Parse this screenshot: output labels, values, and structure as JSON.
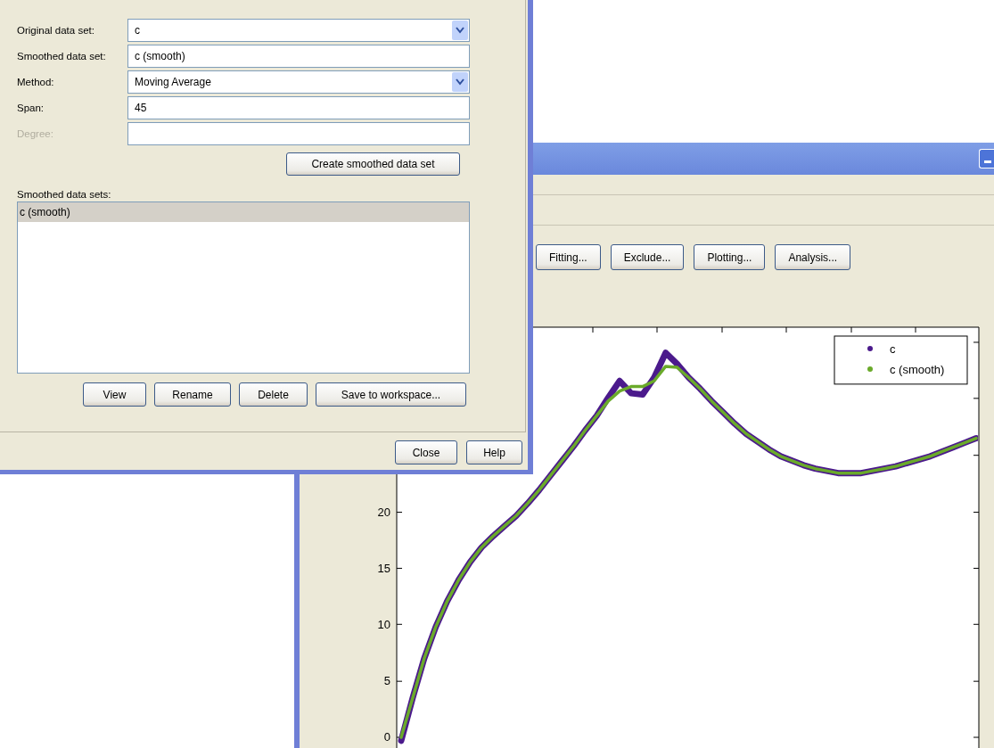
{
  "dialog": {
    "fields": [
      {
        "label": "Original data set:",
        "kind": "dropdown",
        "value": "c",
        "disabled": false
      },
      {
        "label": "Smoothed data set:",
        "kind": "text",
        "value": "c (smooth)",
        "disabled": false
      },
      {
        "label": "Method:",
        "kind": "dropdown",
        "value": "Moving Average",
        "disabled": false
      },
      {
        "label": "Span:",
        "kind": "text",
        "value": "45",
        "disabled": false
      },
      {
        "label": "Degree:",
        "kind": "text",
        "disabled": true
      }
    ],
    "create_button": "Create smoothed data set",
    "list_label": "Smoothed data sets:",
    "list_items": [
      {
        "label": "c (smooth)",
        "selected": true
      }
    ],
    "list_buttons": [
      "View",
      "Rename",
      "Delete",
      "Save to workspace..."
    ],
    "footer_buttons": [
      "Close",
      "Help"
    ]
  },
  "main_window": {
    "toolbar_buttons": [
      "Fitting...",
      "Exclude...",
      "Plotting...",
      "Analysis..."
    ],
    "plot": {
      "chart_data": {
        "type": "line",
        "legend": "upper right",
        "ylim": [
          -0.95,
          36.4
        ],
        "yticks": [
          0,
          5,
          10,
          15,
          20
        ],
        "series": [
          {
            "name": "c",
            "color": "#4b1a8c",
            "values": [
              -0.3,
              3.5,
              7.0,
              9.8,
              12.1,
              14.0,
              15.6,
              16.9,
              17.9,
              18.8,
              19.7,
              20.8,
              22.0,
              23.3,
              24.6,
              25.9,
              27.3,
              28.6,
              30.2,
              31.7,
              30.6,
              30.5,
              32.0,
              34.2,
              33.2,
              32.0,
              31.0,
              29.9,
              28.9,
              27.9,
              27.0,
              26.3,
              25.6,
              25.0,
              24.6,
              24.2,
              23.9,
              23.7,
              23.5,
              23.5,
              23.5,
              23.7,
              23.9,
              24.1,
              24.4,
              24.7,
              25.0,
              25.4,
              25.8,
              26.2,
              26.6
            ]
          },
          {
            "name": "c (smooth)",
            "color": "#6aaa2a",
            "values": [
              0,
              3.5,
              7.0,
              9.8,
              12.1,
              14.0,
              15.6,
              16.9,
              17.9,
              18.8,
              19.7,
              20.8,
              22.0,
              23.3,
              24.6,
              25.9,
              27.3,
              28.6,
              29.9,
              30.8,
              31.2,
              31.2,
              31.7,
              33.0,
              32.9,
              32.0,
              31.0,
              29.9,
              28.9,
              27.9,
              27.0,
              26.3,
              25.6,
              25.0,
              24.6,
              24.2,
              23.9,
              23.7,
              23.5,
              23.5,
              23.5,
              23.7,
              23.9,
              24.1,
              24.4,
              24.7,
              25.0,
              25.4,
              25.8,
              26.2,
              26.6
            ]
          }
        ]
      }
    }
  }
}
